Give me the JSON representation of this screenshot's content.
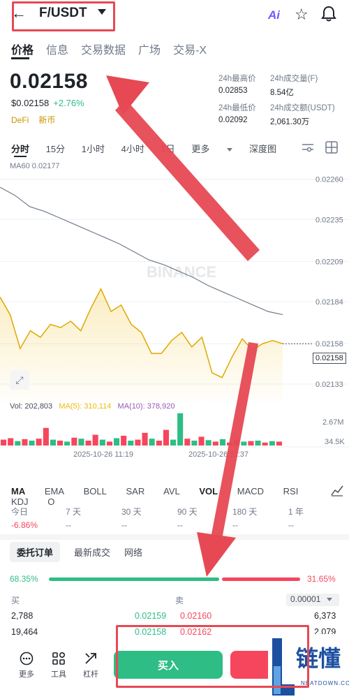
{
  "header": {
    "back_icon": "arrow-left-icon",
    "pair": "F/USDT",
    "ai_label": "Ai",
    "star_icon": "star-icon",
    "bell_icon": "bell-icon"
  },
  "tabs": [
    "价格",
    "信息",
    "交易数据",
    "广场",
    "交易-X"
  ],
  "price": {
    "last": "0.02158",
    "usd": "$0.02158",
    "change": "+2.76%",
    "tag1": "DeFi",
    "tag2": "新币"
  },
  "stats": {
    "high_label": "24h最高价",
    "high": "0.02853",
    "vol_f_label": "24h成交量(F)",
    "vol_f": "8.54亿",
    "low_label": "24h最低价",
    "low": "0.02092",
    "vol_usdt_label": "24h成交额(USDT)",
    "vol_usdt": "2,061.30万"
  },
  "intervals": [
    "分时",
    "15分",
    "1小时",
    "4小时",
    "1日",
    "更多",
    "深度图"
  ],
  "chart_data": {
    "type": "line",
    "ma60_label": "MA60 0.02177",
    "y_ticks": [
      "0.02260",
      "0.02235",
      "0.02209",
      "0.02184",
      "0.02158",
      "0.02133"
    ],
    "price_tag": "0.02158",
    "watermark": "BINANCE",
    "price_series": [
      0.02187,
      0.02176,
      0.02155,
      0.02166,
      0.02162,
      0.0217,
      0.02168,
      0.02172,
      0.02166,
      0.0218,
      0.02192,
      0.02178,
      0.02182,
      0.0217,
      0.02165,
      0.02152,
      0.02152,
      0.0216,
      0.02165,
      0.02156,
      0.02162,
      0.0214,
      0.02137,
      0.0215,
      0.02161,
      0.02154,
      0.02158,
      0.0216,
      0.02158
    ],
    "ma60_series": [
      0.02255,
      0.0225,
      0.02243,
      0.0224,
      0.02236,
      0.02232,
      0.02228,
      0.02224,
      0.0222,
      0.02215,
      0.0221,
      0.02207,
      0.02203,
      0.02199,
      0.02194,
      0.0219,
      0.02186,
      0.02182,
      0.02178,
      0.02176
    ],
    "volume_label": "Vol: 202,803",
    "ma5_label": "MA(5): 310,114",
    "ma10_label": "MA(10): 378,920",
    "vol_ticks": [
      "2.67M",
      "34.5K"
    ],
    "x_ticks": [
      "2025-10-26 11:19",
      "2025-10-26 11:37"
    ],
    "volumes": [
      0.12,
      0.15,
      0.09,
      0.13,
      0.1,
      0.14,
      0.36,
      0.12,
      0.1,
      0.08,
      0.16,
      0.14,
      0.1,
      0.22,
      0.12,
      0.08,
      0.15,
      0.2,
      0.1,
      0.12,
      0.26,
      0.14,
      0.1,
      0.32,
      0.12,
      0.66,
      0.14,
      0.1,
      0.18,
      0.11,
      0.08,
      0.13,
      0.06,
      0.12,
      0.08,
      0.09,
      0.1,
      0.06,
      0.09,
      0.08
    ],
    "volume_colors": [
      "r",
      "r",
      "g",
      "r",
      "g",
      "r",
      "r",
      "g",
      "r",
      "g",
      "r",
      "g",
      "r",
      "r",
      "g",
      "r",
      "g",
      "r",
      "g",
      "r",
      "r",
      "g",
      "r",
      "r",
      "g",
      "g",
      "r",
      "g",
      "r",
      "g",
      "r",
      "g",
      "r",
      "r",
      "g",
      "r",
      "g",
      "r",
      "g",
      "r"
    ]
  },
  "indicators": [
    "MA",
    "EMA",
    "BOLL",
    "SAR",
    "AVL",
    "VOL",
    "MACD",
    "RSI",
    "KDJ",
    "O"
  ],
  "performance": [
    {
      "label": "今日",
      "value": "-6.86%"
    },
    {
      "label": "7 天",
      "value": "--"
    },
    {
      "label": "30 天",
      "value": "--"
    },
    {
      "label": "90 天",
      "value": "--"
    },
    {
      "label": "180 天",
      "value": "--"
    },
    {
      "label": "1 年",
      "value": "--"
    }
  ],
  "orderbook": {
    "tabs": [
      "委托订单",
      "最新成交",
      "网络"
    ],
    "buy_ratio": "68.35%",
    "sell_ratio": "31.65%",
    "buy_label": "买",
    "sell_label": "卖",
    "tick": "0.00001",
    "rows": [
      {
        "bid_qty": "2,788",
        "bid_price": "0.02159",
        "ask_price": "0.02160",
        "ask_qty": "6,373"
      },
      {
        "bid_qty": "19,464",
        "bid_price": "0.02158",
        "ask_price": "0.02162",
        "ask_qty": "2,079"
      }
    ]
  },
  "bottom": {
    "more": "更多",
    "tools": "工具",
    "leverage": "杠杆",
    "buy": "买入"
  },
  "watermark_logo": {
    "cn": "链懂",
    "en": "NEATDOWN.COM"
  },
  "colors": {
    "green": "#2ebd85",
    "red": "#f6465d",
    "annotation": "#e64953"
  }
}
